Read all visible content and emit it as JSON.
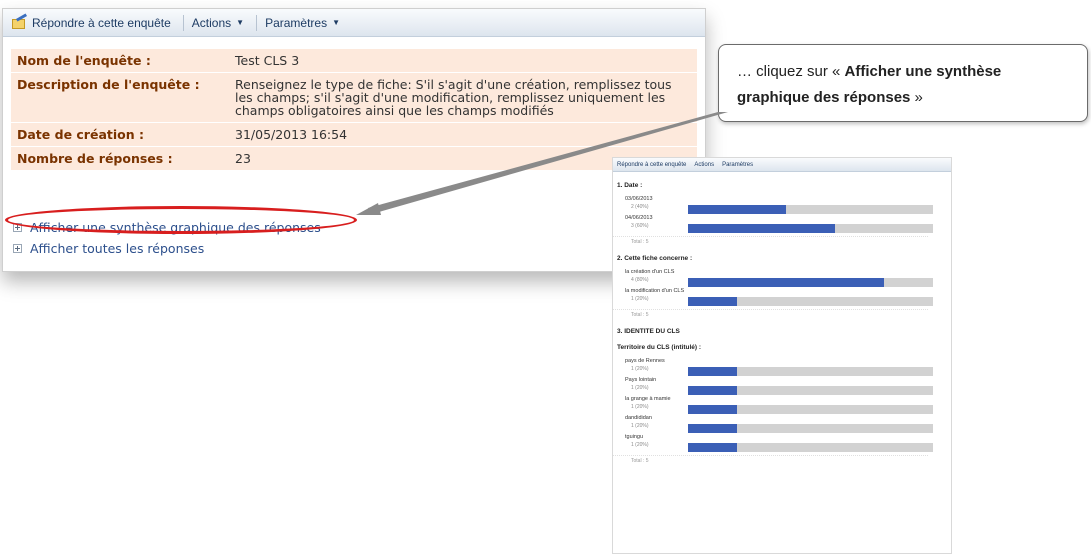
{
  "toolbar": {
    "respond_label": "Répondre à cette enquête",
    "actions_label": "Actions",
    "params_label": "Paramètres"
  },
  "survey_props": [
    {
      "label": "Nom de l'enquête :",
      "value": "Test CLS 3"
    },
    {
      "label": "Description de l'enquête :",
      "value": "Renseignez le type de fiche: S'il s'agit d'une création, remplissez tous les champs; s'il s'agit d'une modification, remplissez uniquement les champs obligatoires ainsi que les champs modifiés"
    },
    {
      "label": "Date de création :",
      "value": "31/05/2013 16:54"
    },
    {
      "label": "Nombre de réponses :",
      "value": "23"
    }
  ],
  "links": {
    "graphic_summary": "Afficher une synthèse graphique des réponses",
    "all_responses": "Afficher toutes les réponses"
  },
  "callout": {
    "prefix": "… cliquez sur « ",
    "bold": "Afficher une synthèse graphique des réponses",
    "suffix": " »"
  },
  "colors": {
    "highlight": "#d81e1e",
    "bar_fill": "#3b5fb6",
    "bar_track": "#d2d2d2",
    "label_bg": "#fde9dc",
    "label_text": "#7a3300"
  },
  "preview": {
    "toolbar": {
      "respond": "Répondre à cette enquête",
      "actions": "Actions",
      "params": "Paramètres"
    },
    "questions": [
      {
        "title": "1. Date :",
        "subtitle": "",
        "items": [
          {
            "label": "03/06/2013",
            "count": "2 (40%)",
            "pct": 40
          },
          {
            "label": "04/06/2013",
            "count": "3 (60%)",
            "pct": 60
          }
        ],
        "total": "Total : 5"
      },
      {
        "title": "2. Cette fiche concerne :",
        "subtitle": "",
        "items": [
          {
            "label": "la création d'un CLS",
            "count": "4 (80%)",
            "pct": 80
          },
          {
            "label": "la modification d'un CLS",
            "count": "1 (20%)",
            "pct": 20
          }
        ],
        "total": "Total : 5"
      },
      {
        "title": "3. IDENTITE DU CLS",
        "subtitle": "Territoire du CLS (intitulé) :",
        "items": [
          {
            "label": "pays de Rennes",
            "count": "1 (20%)",
            "pct": 20
          },
          {
            "label": "Pays lointain",
            "count": "1 (20%)",
            "pct": 20
          },
          {
            "label": "la grange à mamie",
            "count": "1 (20%)",
            "pct": 20
          },
          {
            "label": "dandididan",
            "count": "1 (20%)",
            "pct": 20
          },
          {
            "label": "tguingu",
            "count": "1 (20%)",
            "pct": 20
          }
        ],
        "total": "Total : 5"
      }
    ]
  }
}
